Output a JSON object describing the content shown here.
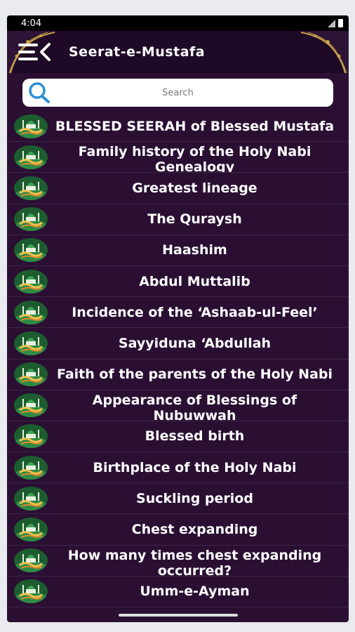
{
  "status": {
    "time": "4:04"
  },
  "app_bar": {
    "title": "Seerat-e-Mustafa",
    "menu_icon": "menu-back-icon"
  },
  "search": {
    "placeholder": "Search",
    "value": ""
  },
  "colors": {
    "background": "#2a0f33",
    "app_bar": "#1e0a26",
    "accent_gold": "#c9a24a",
    "thumb_green": "#1f7a3a"
  },
  "items": [
    {
      "label": "BLESSED SEERAH of Blessed Mustafa"
    },
    {
      "label": "Family history of the Holy Nabi Genealogy"
    },
    {
      "label": "Greatest lineage"
    },
    {
      "label": "The Quraysh"
    },
    {
      "label": "Haashim"
    },
    {
      "label": "Abdul Muttalib"
    },
    {
      "label": "Incidence of the ‘Ashaab-ul-Feel’"
    },
    {
      "label": "Sayyiduna ‘Abdullah"
    },
    {
      "label": "Faith of the parents of the Holy Nabi"
    },
    {
      "label": "Appearance of Blessings of Nubuwwah"
    },
    {
      "label": "Blessed birth"
    },
    {
      "label": "Birthplace of the Holy Nabi"
    },
    {
      "label": "Suckling period"
    },
    {
      "label": "Chest expanding"
    },
    {
      "label": "How many times chest expanding occurred?"
    },
    {
      "label": "Umm-e-Ayman"
    }
  ]
}
